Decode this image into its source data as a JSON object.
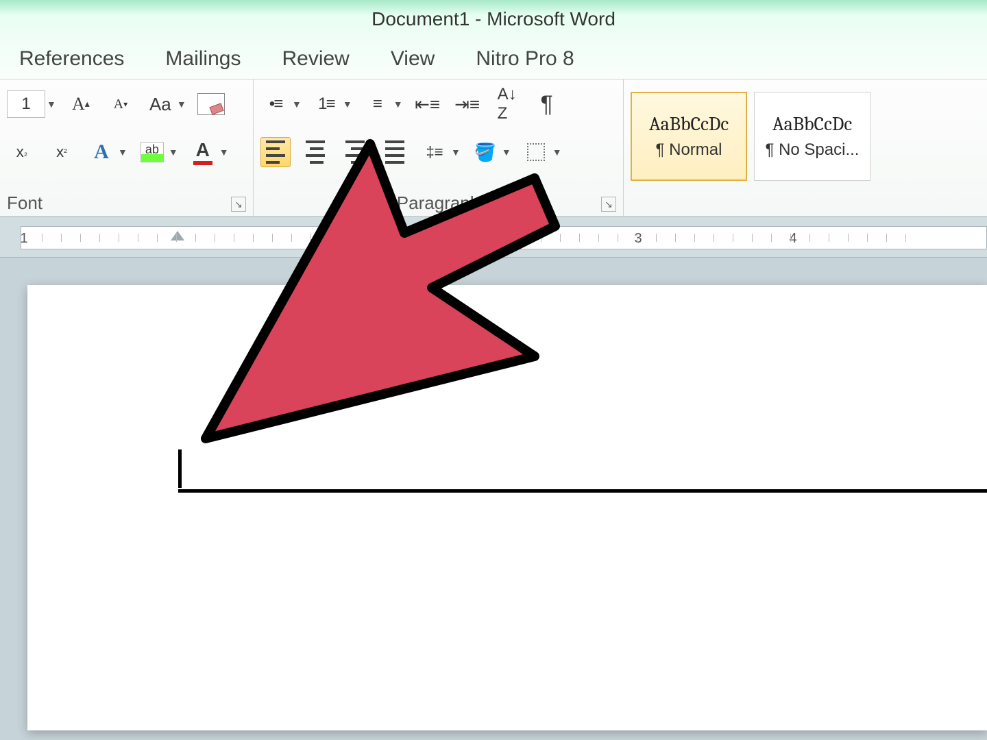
{
  "title": "Document1 - Microsoft Word",
  "tabs": [
    "References",
    "Mailings",
    "Review",
    "View",
    "Nitro Pro 8"
  ],
  "font": {
    "size": "1",
    "group_label": "Font"
  },
  "paragraph": {
    "group_label": "Paragraph"
  },
  "styles": {
    "sample": "AaBbCcDc",
    "items": [
      {
        "name": "¶ Normal",
        "selected": true
      },
      {
        "name": "¶ No Spaci...",
        "selected": false
      }
    ]
  },
  "ruler": {
    "numbers": [
      "1",
      "3",
      "4"
    ]
  }
}
